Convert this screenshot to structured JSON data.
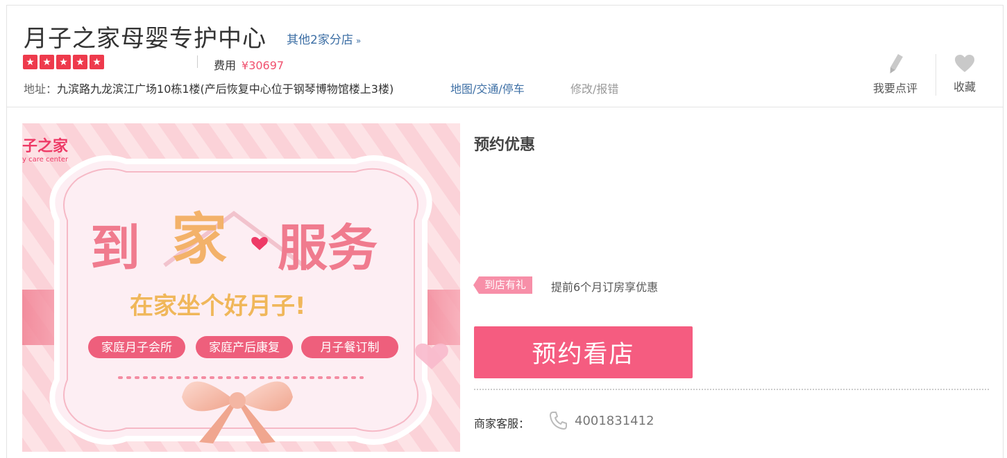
{
  "header": {
    "shop_name": "月子之家母婴专护中心",
    "branches_link": "其他2家分店",
    "branches_chevron": "»",
    "rating_stars": 5,
    "fee_label": "费用",
    "fee_value": "¥30697",
    "address_label": "地址：",
    "address_text": "九滨路九龙滨江广场10栋1楼(产后恢复中心位于钢琴博物馆楼上3楼)",
    "map_link": "地图/交通/停车",
    "edit_link": "修改/报错",
    "review_action": "我要点评",
    "favorite_action": "收藏"
  },
  "banner": {
    "corner_brand": "子之家",
    "corner_brand_en": "y care center",
    "headline_part1": "到",
    "headline_part2": "家",
    "headline_part3": "服务",
    "subline": "在家坐个好月子!",
    "buttons": [
      "家庭月子会所",
      "家庭产后康复",
      "月子餐订制"
    ]
  },
  "promo": {
    "title": "预约优惠",
    "gift_tag": "到店有礼",
    "gift_text": "提前6个月订房享优惠",
    "book_button": "预约看店",
    "service_label": "商家客服：",
    "phone": "4001831412"
  },
  "colors": {
    "accent_pink": "#f55c80",
    "star_red": "#ee3a4c",
    "link_blue": "#3d6fa5",
    "price_pink": "#f0506e"
  },
  "icons": {
    "review": "pencil-icon",
    "favorite": "heart-icon",
    "phone": "phone-icon",
    "star": "star-icon"
  }
}
